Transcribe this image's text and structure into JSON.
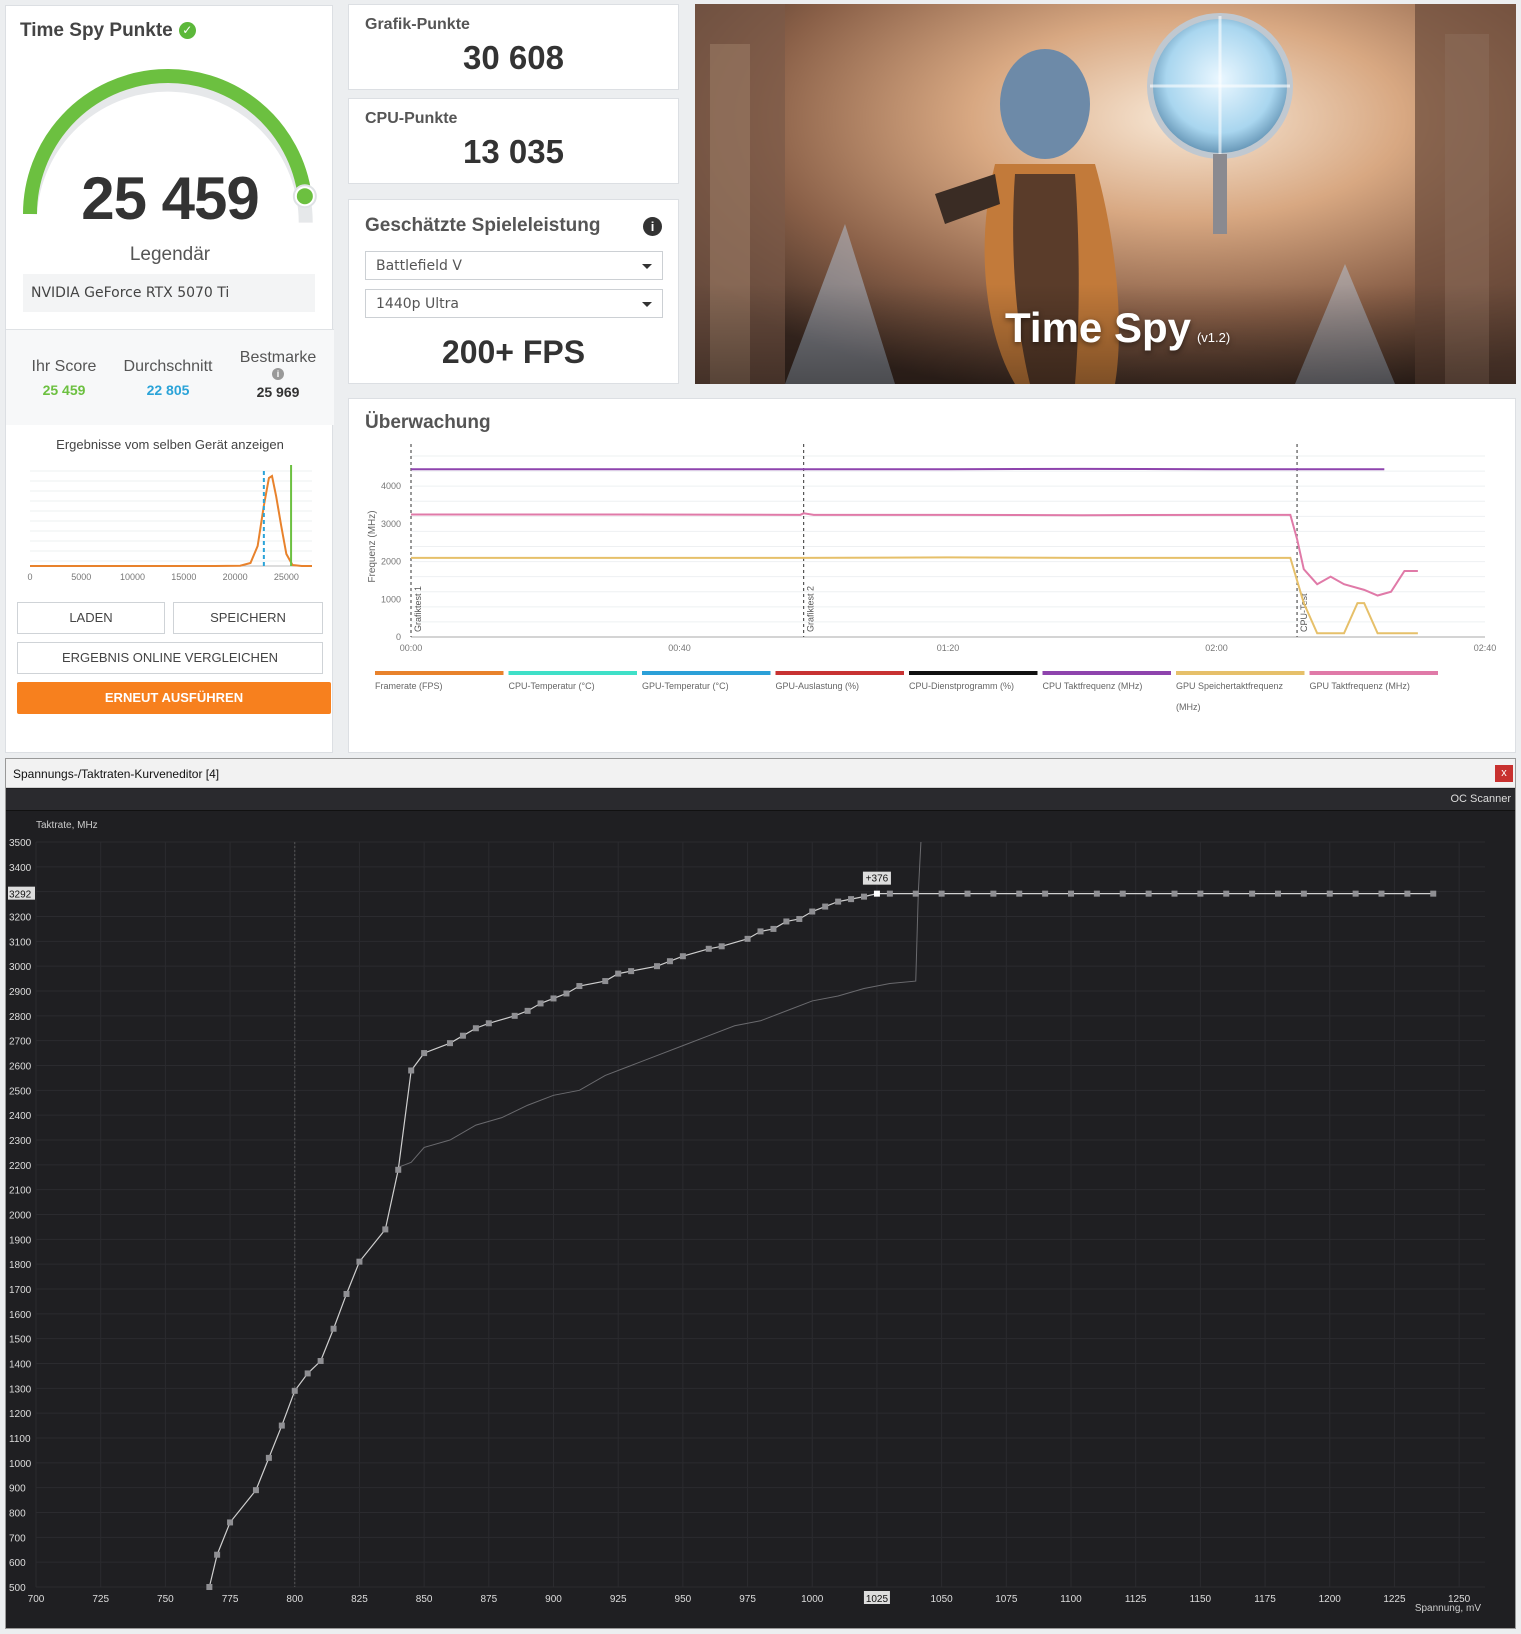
{
  "score_panel": {
    "title": "Time Spy Punkte",
    "score": "25 459",
    "score_fraction": 0.94,
    "rating": "Legendär",
    "gpu": "NVIDIA GeForce RTX 5070 Ti",
    "your_score_label": "Ihr Score",
    "your_score": "25 459",
    "average_label": "Durchschnitt",
    "average": "22 805",
    "best_label": "Bestmarke",
    "best": "25 969",
    "same_device": "Ergebnisse vom selben Gerät anzeigen",
    "histogram_ticks": [
      "0",
      "5000",
      "10000",
      "15000",
      "20000",
      "25000"
    ],
    "buttons": {
      "load": "LADEN",
      "save": "SPEICHERN",
      "compare": "ERGEBNIS ONLINE VERGLEICHEN",
      "rerun": "ERNEUT AUSFÜHREN"
    },
    "colors": {
      "accent_green": "#6cc040",
      "average_blue": "#2aa3d8",
      "orange": "#f7801e"
    }
  },
  "graphics_panel": {
    "title": "Grafik-Punkte",
    "value": "30 608"
  },
  "cpu_panel": {
    "title": "CPU-Punkte",
    "value": "13 035"
  },
  "game_panel": {
    "title": "Geschätzte Spieleleistung",
    "game": "Battlefield V",
    "preset": "1440p Ultra",
    "fps": "200+ FPS"
  },
  "hero": {
    "title": "Time Spy",
    "version": "(v1.2)"
  },
  "monitor": {
    "title": "Überwachung",
    "y_label": "Frequenz (MHz)",
    "y_ticks": [
      "0",
      "1000",
      "2000",
      "3000",
      "4000"
    ],
    "x_ticks": [
      "00:00",
      "00:40",
      "01:20",
      "02:00",
      "02:40"
    ],
    "markers": [
      "Grafiktest 1",
      "Grafiktest 2",
      "CPU-Test"
    ],
    "legend": [
      {
        "label": "Framerate (FPS)",
        "color": "#e8822c"
      },
      {
        "label": "CPU-Temperatur (°C)",
        "color": "#3fe0c8"
      },
      {
        "label": "GPU-Temperatur (°C)",
        "color": "#2ba0d8"
      },
      {
        "label": "GPU-Auslastung (%)",
        "color": "#c83232"
      },
      {
        "label": "CPU-Dienstprogramm (%)",
        "color": "#111111"
      },
      {
        "label": "CPU Taktfrequenz (MHz)",
        "color": "#8e44ad"
      },
      {
        "label": "GPU Speichertaktfrequenz (MHz)",
        "color": "#e6c06a"
      },
      {
        "label": "GPU Taktfrequenz (MHz)",
        "color": "#e07aa8"
      }
    ]
  },
  "oc_editor": {
    "title": "Spannungs-/Taktraten-Kurveneditor [4]",
    "close": "x",
    "scanner": "OC Scanner",
    "y_axis_label": "Taktrate, MHz",
    "x_axis_label": "Spannung, mV",
    "y_ticks": [
      "500",
      "600",
      "700",
      "800",
      "900",
      "1000",
      "1100",
      "1200",
      "1300",
      "1400",
      "1500",
      "1600",
      "1700",
      "1800",
      "1900",
      "2000",
      "2100",
      "2200",
      "2300",
      "2400",
      "2500",
      "2600",
      "2700",
      "2800",
      "2900",
      "3000",
      "3100",
      "3200",
      "3292",
      "3400",
      "3500"
    ],
    "x_ticks": [
      "700",
      "725",
      "750",
      "775",
      "800",
      "825",
      "850",
      "875",
      "900",
      "925",
      "950",
      "975",
      "1000",
      "1025",
      "1050",
      "1075",
      "1100",
      "1125",
      "1150",
      "1175",
      "1200",
      "1225",
      "1250"
    ],
    "selected_point": {
      "voltage": 1025,
      "clock": 3292,
      "offset": "+376"
    }
  },
  "chart_data": [
    {
      "type": "line",
      "title": "Überwachung",
      "ylabel": "Frequenz (MHz)",
      "xlabel": "",
      "xlim": [
        0,
        160
      ],
      "ylim": [
        0,
        4800
      ],
      "x_tick_labels": [
        "00:00",
        "00:40",
        "01:20",
        "02:00",
        "02:40"
      ],
      "series": [
        {
          "name": "CPU Taktfrequenz (MHz)",
          "color": "#8e44ad",
          "x": [
            0,
            40,
            80,
            100,
            120,
            145
          ],
          "y": [
            4450,
            4450,
            4450,
            4460,
            4450,
            4450
          ]
        },
        {
          "name": "GPU Taktfrequenz (MHz)",
          "color": "#e07aa8",
          "x": [
            0,
            30,
            58,
            58.5,
            60,
            80,
            100,
            120,
            131,
            132,
            133,
            135,
            137,
            139,
            142,
            144,
            146,
            148,
            150
          ],
          "y": [
            3250,
            3250,
            3240,
            3280,
            3240,
            3240,
            3230,
            3240,
            3240,
            2600,
            1800,
            1400,
            1600,
            1400,
            1250,
            1100,
            1200,
            1750,
            1750
          ]
        },
        {
          "name": "GPU Speichertaktfrequenz (MHz)",
          "color": "#e6c06a",
          "x": [
            0,
            58,
            80,
            100,
            131,
            132,
            133,
            135,
            137,
            139,
            141,
            142,
            144,
            146,
            148,
            150
          ],
          "y": [
            2100,
            2100,
            2110,
            2100,
            2100,
            1500,
            900,
            100,
            100,
            100,
            900,
            900,
            100,
            100,
            100,
            100
          ]
        }
      ],
      "markers": [
        {
          "x": 0,
          "label": "Grafiktest 1"
        },
        {
          "x": 58.5,
          "label": "Grafiktest 2"
        },
        {
          "x": 132,
          "label": "CPU-Test"
        }
      ]
    },
    {
      "type": "line",
      "title": "",
      "xlabel": "Spannung, mV",
      "ylabel": "Taktrate, MHz",
      "xlim": [
        700,
        1260
      ],
      "ylim": [
        500,
        3500
      ],
      "series": [
        {
          "name": "",
          "x": [
            767,
            770,
            775,
            785,
            790,
            795,
            800,
            805,
            810,
            815,
            820,
            825,
            835,
            840,
            845,
            850,
            860,
            865,
            870,
            875,
            885,
            890,
            895,
            900,
            905,
            910,
            920,
            925,
            930,
            940,
            945,
            950,
            960,
            965,
            975,
            980,
            985,
            990,
            995,
            1000,
            1005,
            1010,
            1015,
            1020,
            1025
          ],
          "y": [
            500,
            630,
            760,
            890,
            1020,
            1150,
            1290,
            1360,
            1410,
            1540,
            1680,
            1810,
            1940,
            2180,
            2580,
            2650,
            2690,
            2720,
            2750,
            2770,
            2800,
            2820,
            2850,
            2870,
            2890,
            2920,
            2940,
            2970,
            2980,
            3000,
            3020,
            3040,
            3070,
            3080,
            3110,
            3140,
            3150,
            3180,
            3190,
            3220,
            3240,
            3260,
            3270,
            3280,
            3292
          ]
        },
        {
          "name": "",
          "x": [
            1025,
            1030,
            1040,
            1050,
            1060,
            1070,
            1080,
            1090,
            1100,
            1110,
            1120,
            1130,
            1140,
            1150,
            1160,
            1170,
            1180,
            1190,
            1200,
            1210,
            1220,
            1230,
            1240
          ],
          "y": [
            3292,
            3292,
            3292,
            3292,
            3292,
            3292,
            3292,
            3292,
            3292,
            3292,
            3292,
            3292,
            3292,
            3292,
            3292,
            3292,
            3292,
            3292,
            3292,
            3292,
            3292,
            3292,
            3292
          ]
        },
        {
          "name": "",
          "x": [
            840,
            845,
            850,
            860,
            870,
            880,
            890,
            900,
            910,
            920,
            930,
            940,
            950,
            960,
            970,
            980,
            990,
            1000,
            1010,
            1020,
            1030,
            1040,
            1041,
            1042
          ],
          "y": [
            2190,
            2210,
            2270,
            2300,
            2360,
            2390,
            2440,
            2480,
            2500,
            2560,
            2600,
            2640,
            2680,
            2720,
            2760,
            2780,
            2820,
            2860,
            2880,
            2910,
            2930,
            2940,
            3300,
            3500
          ]
        }
      ]
    }
  ]
}
